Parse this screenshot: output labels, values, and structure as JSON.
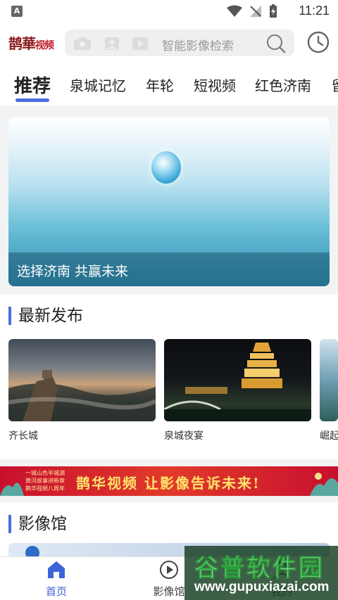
{
  "status_bar": {
    "notification_letter": "A",
    "time": "11:21"
  },
  "header": {
    "logo_main": "鹊華",
    "logo_sub": "视频",
    "search_placeholder": "智能影像检索"
  },
  "tabs": [
    {
      "label": "推荐",
      "active": true
    },
    {
      "label": "泉城记忆",
      "active": false
    },
    {
      "label": "年轮",
      "active": false
    },
    {
      "label": "短视频",
      "active": false
    },
    {
      "label": "红色济南",
      "active": false
    },
    {
      "label": "留",
      "active": false
    }
  ],
  "hero": {
    "caption": "选择济南 共赢未来"
  },
  "latest": {
    "title": "最新发布",
    "items": [
      {
        "label": "齐长城"
      },
      {
        "label": "泉城夜宴"
      },
      {
        "label": "崛起"
      }
    ]
  },
  "banner": {
    "slogan": "鹊华视频 让影像告诉未来!",
    "small_text": "一城山色半城湖 黄河故事讲新章 鹊华视频八周年"
  },
  "gallery": {
    "title": "影像馆"
  },
  "bottom_nav": [
    {
      "label": "首页",
      "active": true
    },
    {
      "label": "影像馆",
      "active": false
    },
    {
      "label": "我的",
      "active": false
    }
  ],
  "watermark": {
    "title": "谷普软件园",
    "url": "www.gupuxiazai.com"
  },
  "colors": {
    "accent": "#4a6ee0",
    "nav_active": "#3d63d8",
    "banner_red": "#c8102e"
  }
}
